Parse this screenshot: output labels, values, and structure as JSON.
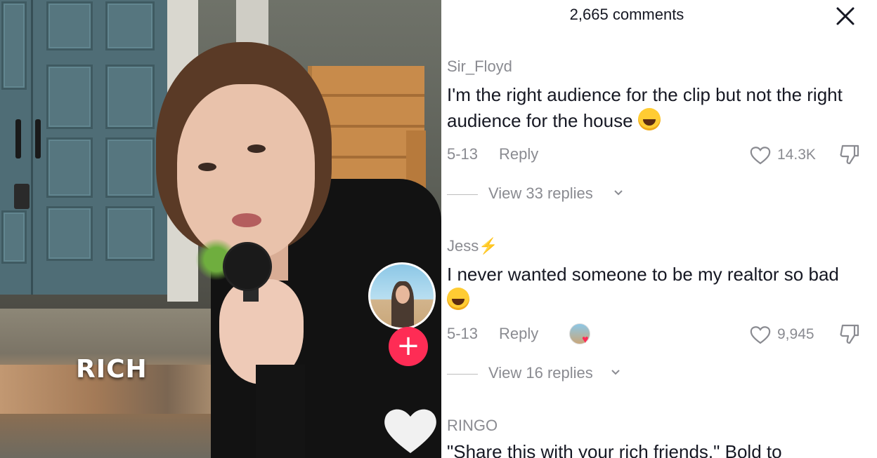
{
  "video": {
    "overlay_text": "RICH",
    "follow_symbol": "+"
  },
  "comments_panel": {
    "count_label": "2,665 comments",
    "close_symbol": "close",
    "comments": [
      {
        "username": "Sir_Floyd",
        "text": "I'm the right audience for the clip but not the right audience for the house",
        "emoji": "sweat-smile-emoji",
        "date": "5-13",
        "reply_label": "Reply",
        "likes": "14.3K",
        "view_replies": "View 33 replies"
      },
      {
        "username": "Jess",
        "username_emoji": "⚡",
        "text": "I never wanted someone to be my realtor so bad",
        "emoji": "tears-of-joy-emoji",
        "date": "5-13",
        "reply_label": "Reply",
        "liked_by_creator": true,
        "likes": "9,945",
        "view_replies": "View 16 replies"
      },
      {
        "username": "RINGO",
        "text": "\"Share this with your rich friends.\" Bold to"
      }
    ]
  },
  "colors": {
    "accent": "#fe2c55",
    "muted_text": "#8a8b91",
    "primary_text": "#161823"
  }
}
